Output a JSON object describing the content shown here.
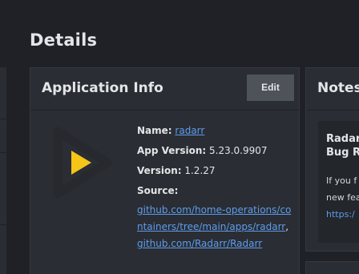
{
  "page": {
    "title": "Details"
  },
  "app_info": {
    "title": "Application Info",
    "edit_label": "Edit",
    "name_label": "Name:",
    "name_value": "radarr",
    "app_version_label": "App Version:",
    "app_version_value": "5.23.0.9907",
    "version_label": "Version:",
    "version_value": "1.2.27",
    "source_label": "Source:",
    "source_link_1": "github.com/home-operations/containers/tree/main/apps/radarr",
    "source_link_separator": ",",
    "source_link_2": "github.com/Radarr/Radarr",
    "logo_icon": "radarr-logo-icon",
    "colors": {
      "logo_ring": "#27292e",
      "logo_play": "#f5c518",
      "link": "#5d9cec"
    }
  },
  "notes": {
    "title": "Notes",
    "heading_line_1": "Radar",
    "heading_line_2": "Bug R",
    "body_line_1": "If you f",
    "body_line_2": "new fea",
    "body_line_3": "https:/"
  }
}
